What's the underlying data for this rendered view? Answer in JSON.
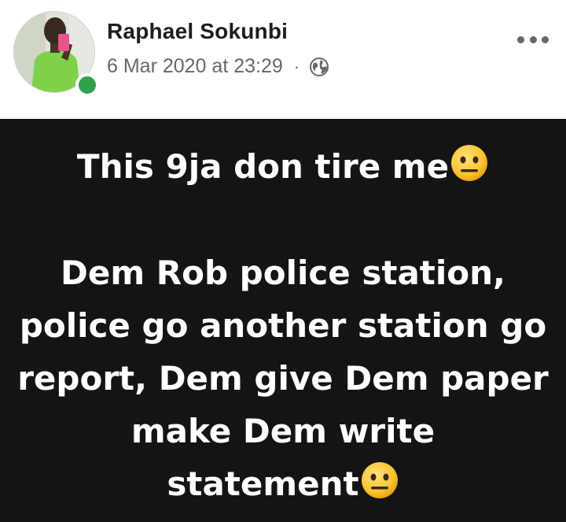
{
  "post": {
    "author_name": "Raphael Sokunbi",
    "timestamp": "6 Mar 2020 at 23:29",
    "separator": "·",
    "privacy_icon": "globe-icon",
    "more_icon": "more-options-icon",
    "online_status": "online",
    "avatar_icon": "profile-photo",
    "text_line_1": "This 9ja don tire me",
    "text_paragraph_2_line_1": "Dem Rob police station,",
    "text_paragraph_2_line_2": "police go another station go",
    "text_paragraph_2_line_3": "report, Dem give Dem paper",
    "text_paragraph_2_line_4": "make Dem write",
    "text_paragraph_2_line_5": "statement",
    "emoji": "neutral-face-emoji"
  },
  "colors": {
    "background_dark": "#141414",
    "text_light": "#ffffff",
    "author_text": "#1c1e21",
    "meta_text": "#65676b",
    "online_green": "#31a24c",
    "emoji_yellow": "#f9c22e"
  }
}
